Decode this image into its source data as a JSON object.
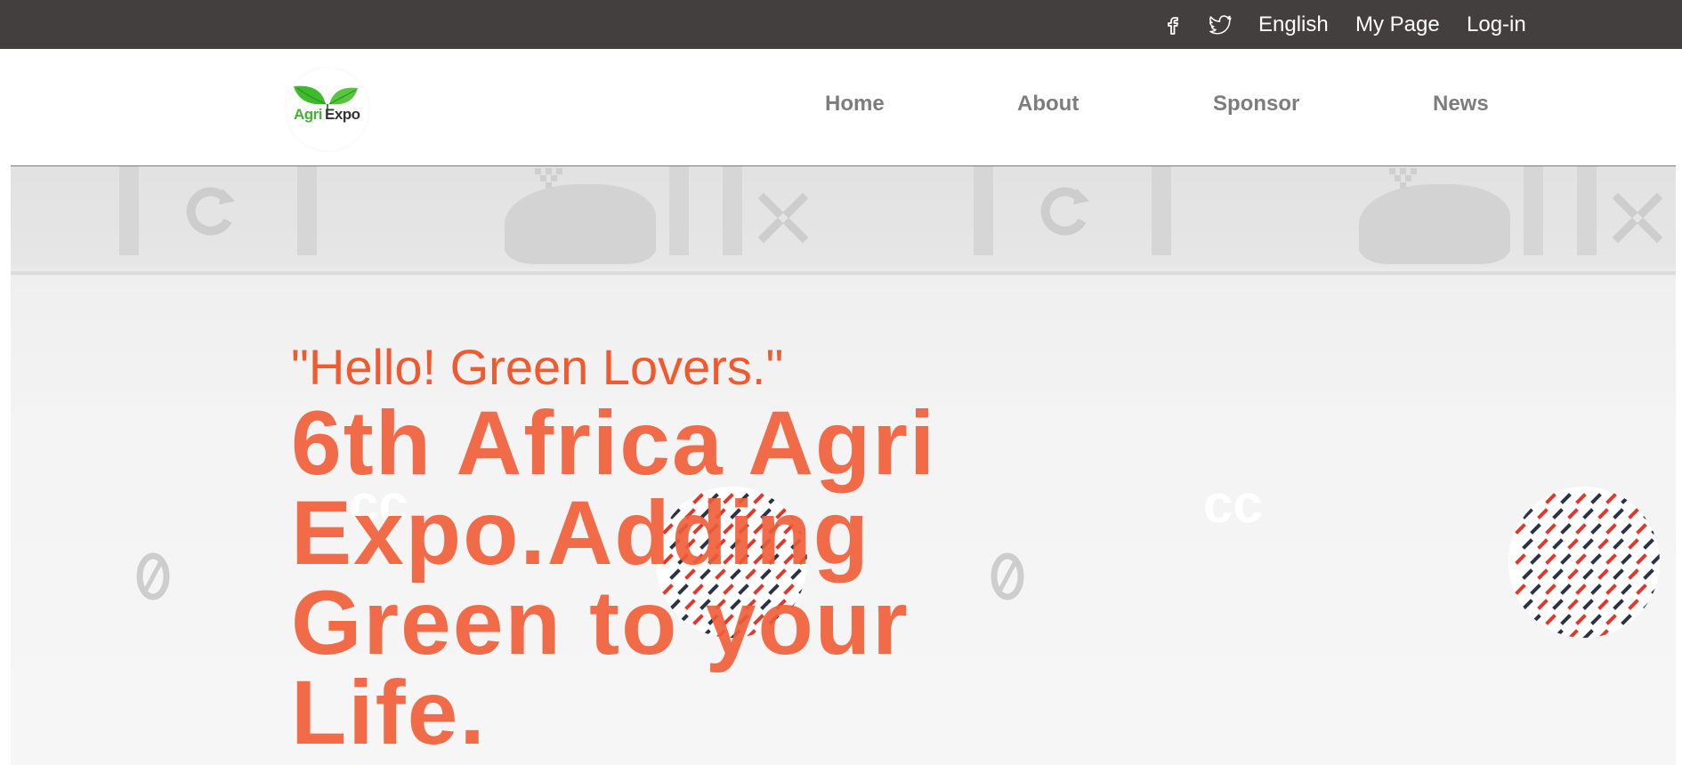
{
  "topbar": {
    "social": [
      {
        "icon": "facebook-icon"
      },
      {
        "icon": "twitter-icon"
      }
    ],
    "language": "English",
    "my_page": "My Page",
    "login": "Log-in"
  },
  "header": {
    "logo": {
      "word1": "Agri",
      "word2": "Expo",
      "leaf_color": "#3dbb2c"
    },
    "nav": [
      {
        "label": "Home"
      },
      {
        "label": "About"
      },
      {
        "label": "Sponsor"
      },
      {
        "label": "News"
      }
    ]
  },
  "hero": {
    "greeting": "\"Hello! Green Lovers.\"",
    "title": "6th Africa Agri Expo.Adding Green to your Life.",
    "accent_color": "#f2603a",
    "pattern_colors": [
      "#e2382b",
      "#2b3344"
    ]
  },
  "colors": {
    "topbar_bg": "#433f3e",
    "nav_text": "#7d7d7d"
  }
}
